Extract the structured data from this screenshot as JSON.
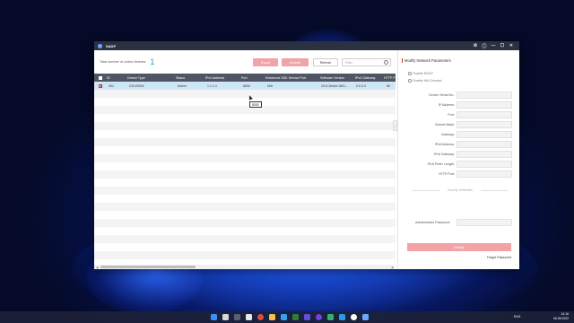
{
  "window": {
    "title": "SADP"
  },
  "toolbar": {
    "total_label": "Total number of online devices:",
    "total_count": "1",
    "export_label": "Export",
    "activate_label": "Activate",
    "refresh_label": "Refresh",
    "filter_placeholder": "Filter"
  },
  "table": {
    "headers": [
      "ID",
      "Device Type",
      "Status",
      "IPv4 Address",
      "Port",
      "Enhanced SDK Service Port",
      "Software Version",
      "IPv4 Gateway",
      "HTTP Port"
    ],
    "rows": [
      [
        "001",
        "DS-I250W",
        "Active",
        "1.1.1.1",
        "8000",
        "N/A",
        "V5.5.2build 1801...",
        "0.0.0.0",
        "80"
      ]
    ],
    "tooltip": "8000"
  },
  "panel": {
    "title": "Modify Network Parameters",
    "enable_dhcp": "Enable DHCP",
    "enable_hik_connect": "Enable Hik-Connect",
    "fields": [
      "Device Serial No.:",
      "IP Address:",
      "Port:",
      "Subnet Mask:",
      "Gateway:",
      "IPv6 Address:",
      "IPv6 Gateway:",
      "IPv6 Prefix Length:",
      "HTTP Port:"
    ],
    "security_label": "Security Verification",
    "admin_password_label": "Administrator Password:",
    "modify_button": "Modify",
    "forgot_password": "Forgot Password"
  },
  "taskbar": {
    "language": "ENG",
    "time": "14:16",
    "date": "06.08.2022"
  },
  "colors": {
    "accent_count": "#1aa0d8",
    "disabled_button": "#f1a3a8",
    "header_bg": "#4f5563",
    "selected_row": "#cfe6f7"
  }
}
